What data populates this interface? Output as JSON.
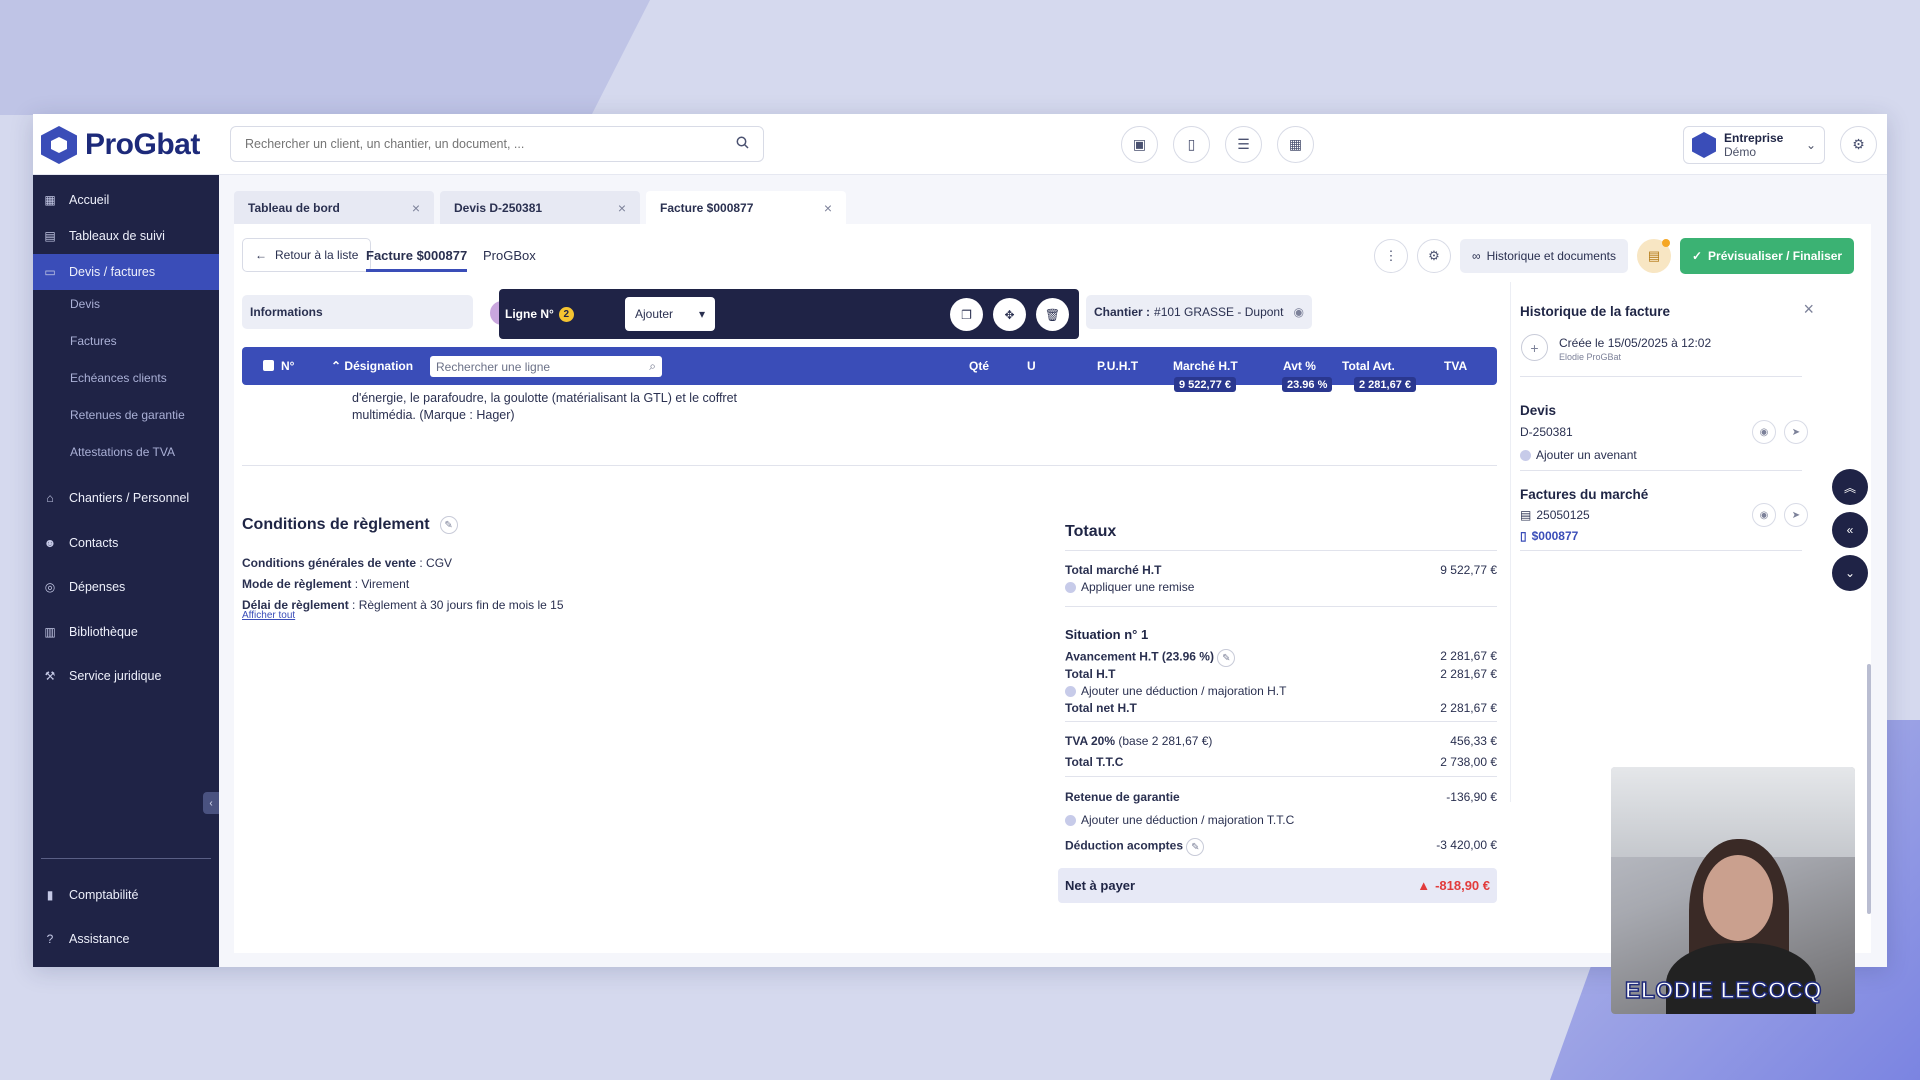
{
  "topbar": {
    "logo_text": "ProGbat",
    "search_placeholder": "Rechercher un client, un chantier, un document, ...",
    "company_name": "Entreprise",
    "company_sub": "Démo"
  },
  "sidebar": {
    "items": [
      {
        "label": "Accueil",
        "icon": "home-grid-icon"
      },
      {
        "label": "Tableaux de suivi",
        "icon": "chart-icon"
      },
      {
        "label": "Devis / factures",
        "icon": "document-icon"
      },
      {
        "label": "Chantiers / Personnel",
        "icon": "house-icon"
      },
      {
        "label": "Contacts",
        "icon": "people-icon"
      },
      {
        "label": "Dépenses",
        "icon": "wallet-icon"
      },
      {
        "label": "Bibliothèque",
        "icon": "book-icon"
      },
      {
        "label": "Service juridique",
        "icon": "gavel-icon"
      },
      {
        "label": "Comptabilité",
        "icon": "bar-chart-icon"
      },
      {
        "label": "Assistance",
        "icon": "help-icon"
      }
    ],
    "sub_items": [
      "Devis",
      "Factures",
      "Echéances clients",
      "Retenues de garantie",
      "Attestations de TVA"
    ]
  },
  "tabs": [
    "Tableau de bord",
    "Devis D-250381",
    "Facture $000877"
  ],
  "toolbar": {
    "back_label": "Retour à la liste",
    "subtab_active": "Facture $000877",
    "subtab_other": "ProGBox",
    "history_label": "Historique et documents",
    "finalize_label": "Prévisualiser / Finaliser"
  },
  "editor": {
    "info_label": "Informations",
    "ligne_label": "Ligne N°",
    "ligne_badge": "2",
    "ajouter_label": "Ajouter",
    "chantier_label": "Chantier :",
    "chantier_value": "#101 GRASSE - Dupont"
  },
  "table": {
    "headers": {
      "num": "N°",
      "designation": "Désignation",
      "search_placeholder": "Rechercher une ligne",
      "qte": "Qté",
      "unit": "U",
      "puht": "P.U.H.T",
      "marche": "Marché H.T",
      "avt": "Avt %",
      "total_avt": "Total Avt.",
      "tva": "TVA"
    },
    "sums": {
      "marche": "9 522,77 €",
      "avt": "23.96 %",
      "total_avt": "2 281,67 €"
    },
    "description": "d'énergie, le parafoudre, la goulotte (matérialisant la GTL) et le coffret multimédia. (Marque : Hager)"
  },
  "conditions": {
    "title": "Conditions de règlement",
    "cgv_label": "Conditions générales de vente",
    "cgv_value": " : CGV",
    "mode_label": "Mode de règlement",
    "mode_value": " : Virement",
    "delai_label": "Délai de règlement",
    "delai_value": " : Règlement à 30 jours fin de mois le 15",
    "show_all": "Afficher tout"
  },
  "totals": {
    "title": "Totaux",
    "total_marche_label": "Total marché H.T",
    "total_marche_value": "9 522,77 €",
    "remise_label": "Appliquer une remise",
    "situation_title": "Situation n° 1",
    "avancement_label": "Avancement H.T (23.96 %)",
    "avancement_value": "2 281,67 €",
    "total_ht_label": "Total H.T",
    "total_ht_value": "2 281,67 €",
    "deduction_ht_label": "Ajouter une déduction / majoration H.T",
    "total_net_label": "Total net H.T",
    "total_net_value": "2 281,67 €",
    "tva_label": "TVA 20%",
    "tva_base": " (base 2 281,67 €)",
    "tva_value": "456,33 €",
    "ttc_label": "Total T.T.C",
    "ttc_value": "2 738,00 €",
    "retenue_label": "Retenue de garantie",
    "retenue_value": "-136,90 €",
    "deduction_ttc_label": "Ajouter une déduction / majoration T.T.C",
    "acomptes_label": "Déduction acomptes",
    "acomptes_value": "-3 420,00 €",
    "net_label": "Net à payer",
    "net_value": "-818,90 €"
  },
  "history": {
    "title": "Historique de la facture",
    "created": "Créée le 15/05/2025 à 12:02",
    "created_by": "Elodie ProGBat",
    "devis_title": "Devis",
    "devis_ref": "D-250381",
    "avenant_label": "Ajouter un avenant",
    "factures_title": "Factures du marché",
    "facture_1": "25050125",
    "facture_2": "$000877"
  },
  "video": {
    "name": "ELODIE LECOCQ"
  },
  "colors": {
    "accent": "#3a4db8",
    "sidebar": "#1f2346",
    "success": "#3bb273",
    "danger": "#e23b3b"
  }
}
